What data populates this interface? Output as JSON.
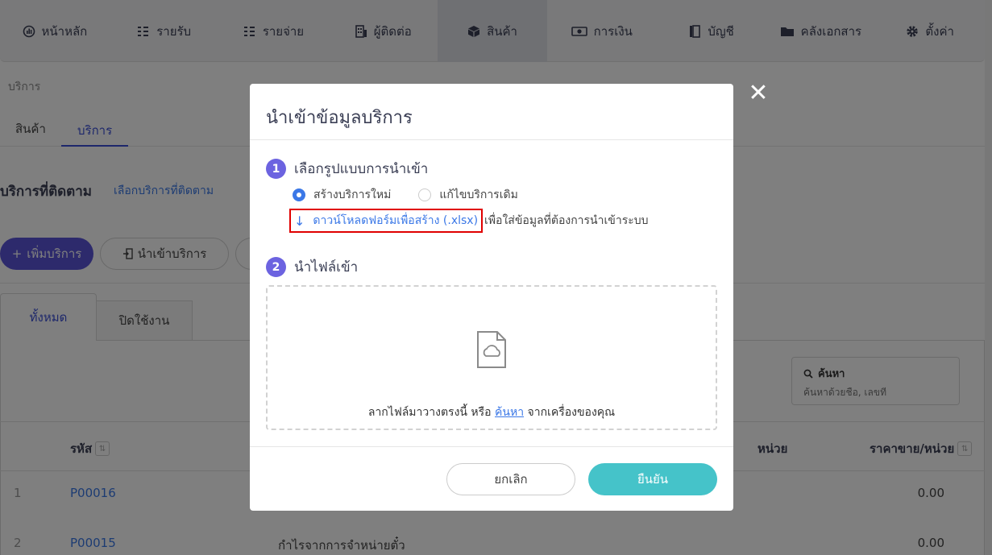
{
  "nav": {
    "items": [
      {
        "label": "หน้าหลัก",
        "icon": "dashboard-icon"
      },
      {
        "label": "รายรับ",
        "icon": "income-list-icon"
      },
      {
        "label": "รายจ่าย",
        "icon": "expense-list-icon"
      },
      {
        "label": "ผู้ติดต่อ",
        "icon": "contacts-icon"
      },
      {
        "label": "สินค้า",
        "icon": "box-icon"
      },
      {
        "label": "การเงิน",
        "icon": "money-icon"
      },
      {
        "label": "บัญชี",
        "icon": "book-icon"
      },
      {
        "label": "คลังเอกสาร",
        "icon": "folder-icon"
      },
      {
        "label": "ตั้งค่า",
        "icon": "gear-icon"
      }
    ]
  },
  "breadcrumb": "บริการ",
  "subtabs": [
    "สินค้า",
    "บริการ"
  ],
  "follow": {
    "title": "บริการที่ติดตาม",
    "link": "เลือกบริการที่ติดตาม"
  },
  "buttons": {
    "add": "เพิ่มบริการ",
    "import": "นำเข้าบริการ"
  },
  "list_tabs": [
    "ทั้งหมด",
    "ปิดใช้งาน"
  ],
  "search": {
    "label": "ค้นหา",
    "placeholder": "ค้นหาด้วยชื่อ, เลขที่"
  },
  "table": {
    "headers": {
      "code": "รหัส",
      "unit": "หน่วย",
      "price": "ราคาขาย/หน่วย"
    },
    "rows": [
      {
        "index": "1",
        "code": "P00016",
        "name": "",
        "price": "0.00"
      },
      {
        "index": "2",
        "code": "P00015",
        "name": "กำไรจากการจำหน่ายตั๋ว",
        "price": "0.00"
      }
    ]
  },
  "modal": {
    "title": "นำเข้าข้อมูลบริการ",
    "step1": {
      "num": "1",
      "title": "เลือกรูปแบบการนำเข้า"
    },
    "options": [
      {
        "label": "สร้างบริการใหม่",
        "checked": true
      },
      {
        "label": "แก้ไขบริการเดิม",
        "checked": false
      }
    ],
    "download_link": "ดาวน์โหลดฟอร์มเพื่อสร้าง (.xlsx)",
    "download_rest": "เพื่อใส่ข้อมูลที่ต้องการนำเข้าระบบ",
    "step2": {
      "num": "2",
      "title": "นำไฟล์เข้า"
    },
    "drop_text_before": "ลากไฟล์มาวางตรงนี้ หรือ ",
    "drop_link": "ค้นหา",
    "drop_text_after": " จากเครื่องของคุณ",
    "cancel": "ยกเลิก",
    "confirm": "ยืนยัน"
  },
  "colors": {
    "primary": "#5b55d8",
    "confirm": "#45c3c9",
    "link": "#3b78e7",
    "highlight": "#e00000"
  }
}
